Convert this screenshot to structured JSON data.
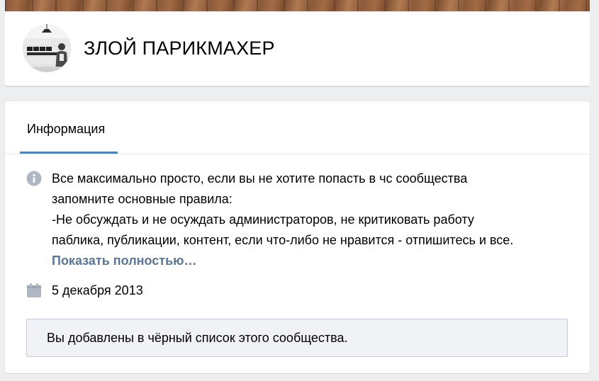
{
  "community": {
    "title": "ЗЛОЙ ПАРИКМАХЕР"
  },
  "tabs": [
    {
      "label": "Информация",
      "active": true
    }
  ],
  "info": {
    "description_lines": [
      "Все максимально просто, если вы не хотите попасть в чс сообщества",
      "запомните основные правила:",
      "-Не обсуждать и не осуждать администраторов, не критиковать работу",
      "паблика, публикации, контент, если что-либо не нравится - отпишитесь и все."
    ],
    "show_more": "Показать полностью…",
    "created_date": "5 декабря 2013"
  },
  "notice": {
    "blacklist_text": "Вы добавлены в чёрный список этого сообщества."
  },
  "icons": {
    "description": "info-circle-icon",
    "date": "calendar-icon"
  },
  "colors": {
    "background": "#edeef0",
    "card": "#ffffff",
    "tab_underline": "#5181b8",
    "link": "#5b7696",
    "icon_gray": "#aeb7c2",
    "notice_bg": "#f0f2f5",
    "notice_border": "#c5cdd8"
  }
}
